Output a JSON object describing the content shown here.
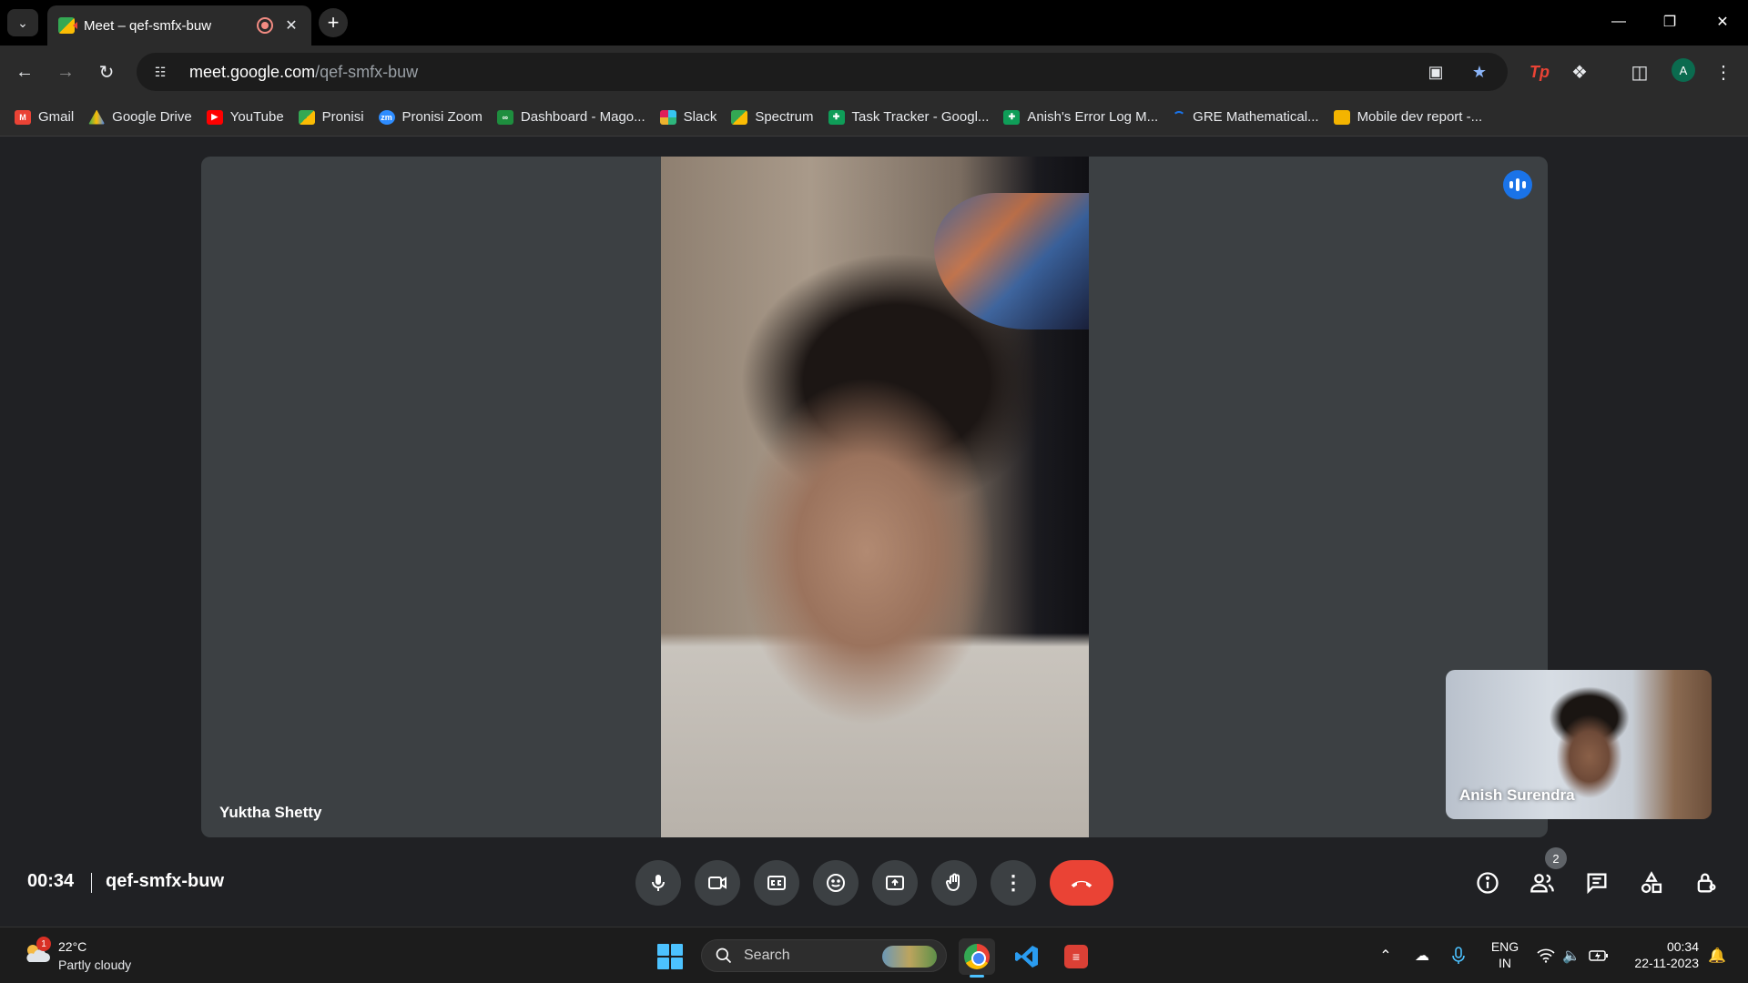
{
  "browser": {
    "tab": {
      "title": "Meet – qef-smfx-buw"
    },
    "new_tab_symbol": "+",
    "url_host": "meet.google.com",
    "url_path": "/qef-smfx-buw",
    "profile_initial": "A",
    "bookmarks": [
      {
        "label": "Gmail",
        "icon": "gmail-icon",
        "color": "#ea4335"
      },
      {
        "label": "Google Drive",
        "icon": "google-drive-icon",
        "color": "#fbbc04"
      },
      {
        "label": "YouTube",
        "icon": "youtube-icon",
        "color": "#ff0000"
      },
      {
        "label": "Pronisi",
        "icon": "meet-icon",
        "color": "#34a853"
      },
      {
        "label": "Pronisi Zoom",
        "icon": "zoom-icon",
        "color": "#2d8cff"
      },
      {
        "label": "Dashboard - Mago...",
        "icon": "dashboard-icon",
        "color": "#1e8e3e"
      },
      {
        "label": "Slack",
        "icon": "slack-icon",
        "color": "#e01e5a"
      },
      {
        "label": "Spectrum",
        "icon": "meet-icon",
        "color": "#34a853"
      },
      {
        "label": "Task Tracker - Googl...",
        "icon": "sheets-icon",
        "color": "#0f9d58"
      },
      {
        "label": "Anish's Error Log M...",
        "icon": "sheets-icon",
        "color": "#0f9d58"
      },
      {
        "label": "GRE Mathematical...",
        "icon": "loading-icon",
        "color": "#1a73e8"
      },
      {
        "label": "Mobile dev report -...",
        "icon": "slides-icon",
        "color": "#f4b400"
      }
    ]
  },
  "meet": {
    "main_participant": "Yuktha Shetty",
    "self_participant": "Anish Surendra",
    "time": "00:34",
    "meeting_code": "qef-smfx-buw",
    "participants_count": "2",
    "accent_end_call": "#ea4335",
    "accent_speaking": "#1a73e8"
  },
  "taskbar": {
    "weather_badge": "1",
    "temperature": "22°C",
    "weather": "Partly cloudy",
    "search_label": "Search",
    "lang_primary": "ENG",
    "lang_secondary": "IN",
    "clock_time": "00:34",
    "clock_date": "22-11-2023"
  }
}
